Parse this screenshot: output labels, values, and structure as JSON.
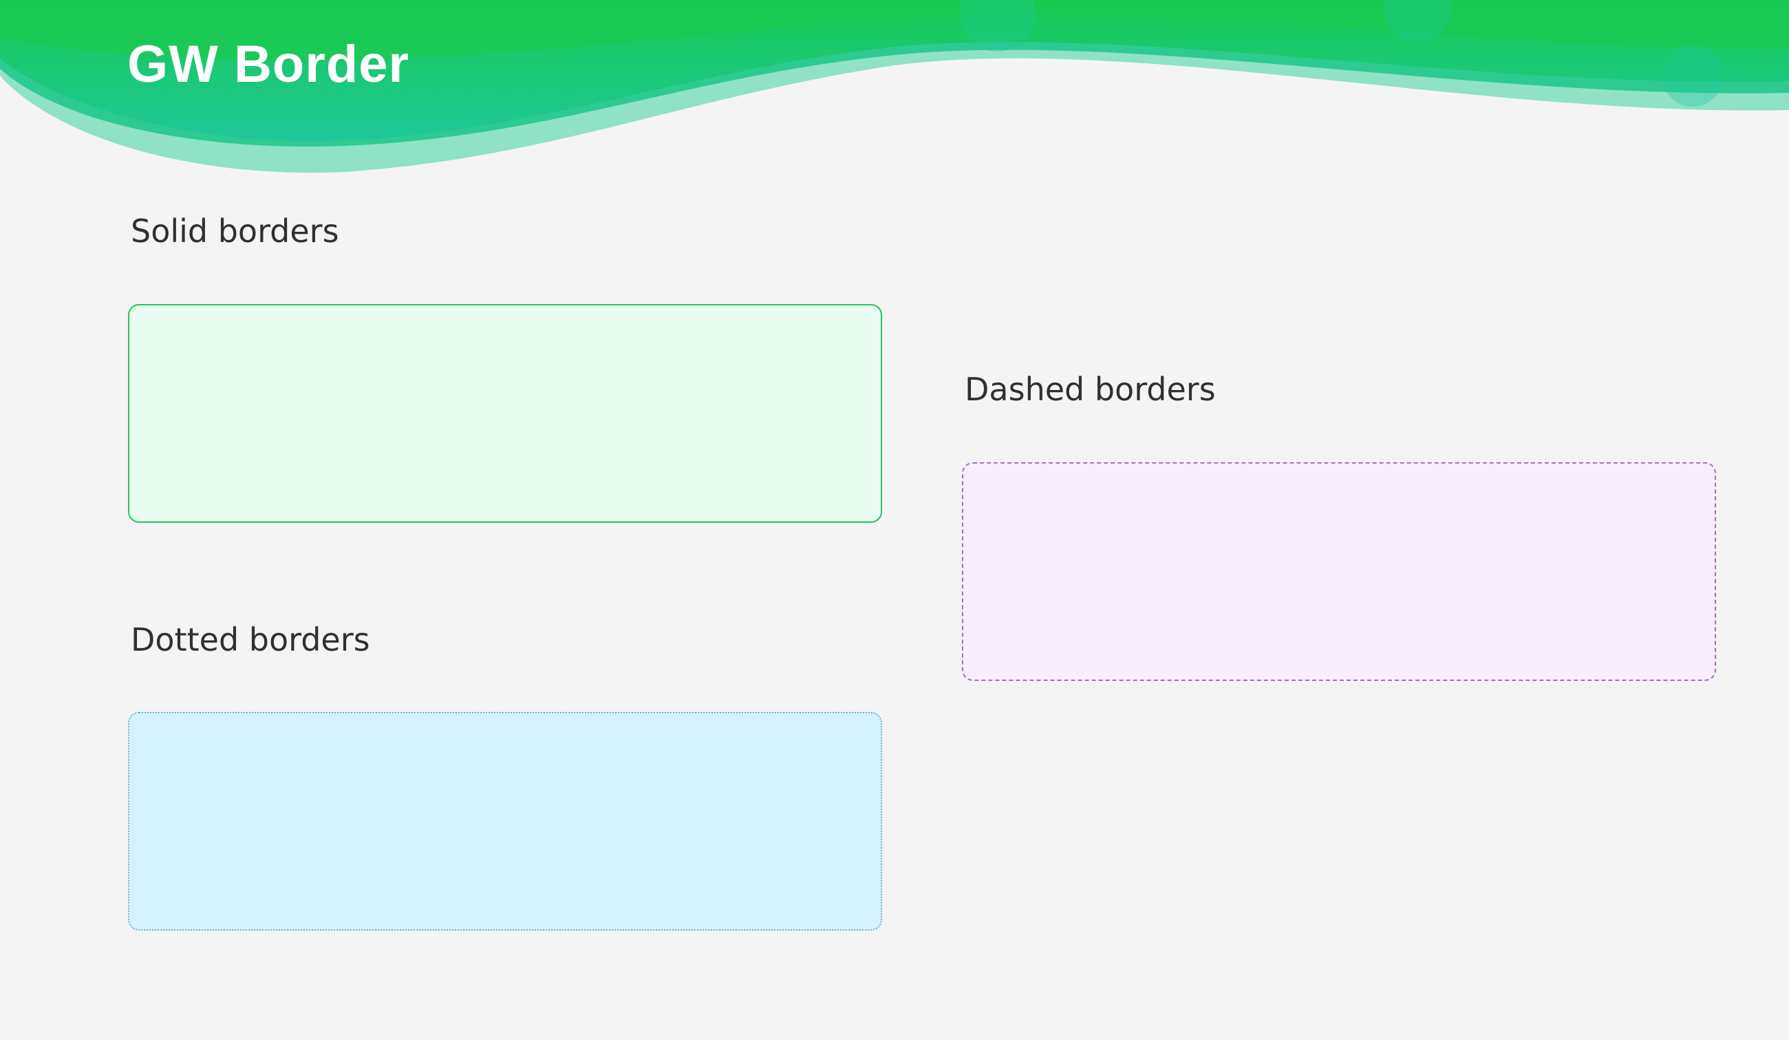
{
  "app": {
    "title": "GW Border"
  },
  "theme": {
    "background": "#f4f4f4",
    "header_green": "#19c94f",
    "header_teal": "#1ec79a",
    "heading_text": "#303030"
  },
  "sections": {
    "solid": {
      "heading": "Solid borders",
      "border_style": "solid",
      "border_color": "#22c55e",
      "fill_color": "#e8fdf0"
    },
    "dashed": {
      "heading": "Dashed borders",
      "border_style": "dashed",
      "border_color": "#a86fc0",
      "fill_color": "#f9eefd"
    },
    "dotted": {
      "heading": "Dotted borders",
      "border_style": "dotted",
      "border_color": "#7aaec8",
      "fill_color": "#d4f2fc"
    }
  }
}
